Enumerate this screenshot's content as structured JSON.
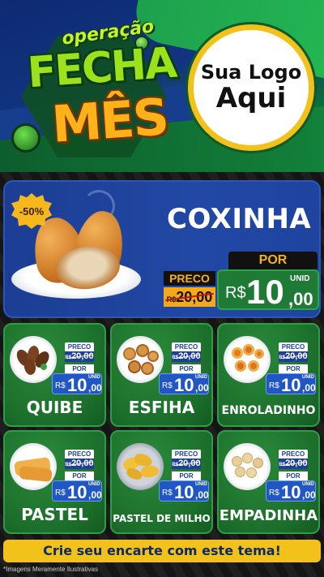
{
  "header": {
    "campaign_top": "operação",
    "campaign_mid": "FECHA",
    "campaign_bottom": "MÊS",
    "logo_line1": "Sua Logo",
    "logo_line2": "Aqui"
  },
  "featured": {
    "discount_badge": "-50%",
    "name": "COXINHA",
    "preco_label": "PRECO",
    "old_currency": "R$",
    "old_price": "20,00",
    "por_label": "POR",
    "currency": "R$",
    "price_int": "10",
    "price_dec": ",00",
    "unit": "UNID"
  },
  "labels": {
    "preco": "PRECO",
    "por": "POR",
    "currency": "R$",
    "unit": "UNID"
  },
  "products": [
    {
      "name": "QUIBE",
      "old_price": "20,00",
      "price_int": "10",
      "price_dec": ",00"
    },
    {
      "name": "ESFIHA",
      "old_price": "20,00",
      "price_int": "10",
      "price_dec": ",00"
    },
    {
      "name": "ENROLADINHO",
      "old_price": "20,00",
      "price_int": "10",
      "price_dec": ",00"
    },
    {
      "name": "PASTEL",
      "old_price": "20,00",
      "price_int": "10",
      "price_dec": ",00"
    },
    {
      "name": "PASTEL DE MILHO",
      "old_price": "20,00",
      "price_int": "10",
      "price_dec": ",00"
    },
    {
      "name": "EMPADINHA",
      "old_price": "20,00",
      "price_int": "10",
      "price_dec": ",00"
    }
  ],
  "footer": {
    "cta": "Crie seu encarte com este tema!",
    "disclaimer": "*Imagens Meramente Ilustrativas"
  },
  "colors": {
    "header_blue": "#12357f",
    "accent_green": "#1f7a35",
    "badge_yellow": "#f6b81c",
    "price_blue": "#2057c4"
  }
}
